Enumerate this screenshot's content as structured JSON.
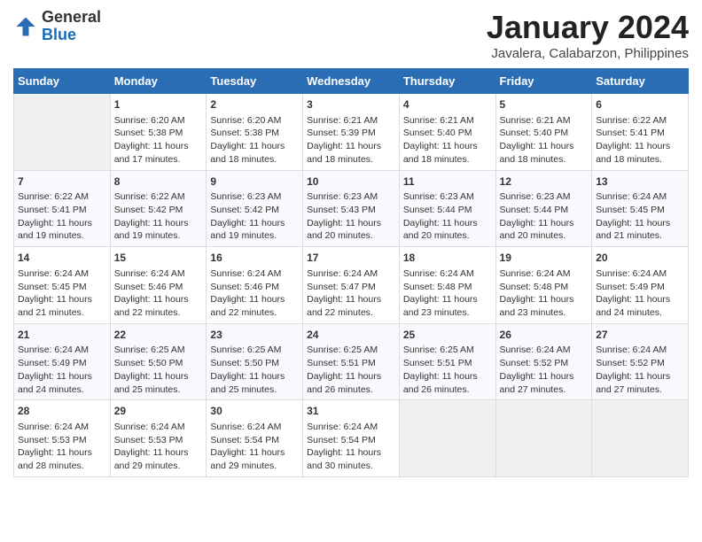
{
  "logo": {
    "general": "General",
    "blue": "Blue"
  },
  "header": {
    "month": "January 2024",
    "location": "Javalera, Calabarzon, Philippines"
  },
  "weekdays": [
    "Sunday",
    "Monday",
    "Tuesday",
    "Wednesday",
    "Thursday",
    "Friday",
    "Saturday"
  ],
  "weeks": [
    [
      {
        "day": "",
        "empty": true
      },
      {
        "day": "1",
        "sunrise": "6:20 AM",
        "sunset": "5:38 PM",
        "daylight": "11 hours and 17 minutes."
      },
      {
        "day": "2",
        "sunrise": "6:20 AM",
        "sunset": "5:38 PM",
        "daylight": "11 hours and 18 minutes."
      },
      {
        "day": "3",
        "sunrise": "6:21 AM",
        "sunset": "5:39 PM",
        "daylight": "11 hours and 18 minutes."
      },
      {
        "day": "4",
        "sunrise": "6:21 AM",
        "sunset": "5:40 PM",
        "daylight": "11 hours and 18 minutes."
      },
      {
        "day": "5",
        "sunrise": "6:21 AM",
        "sunset": "5:40 PM",
        "daylight": "11 hours and 18 minutes."
      },
      {
        "day": "6",
        "sunrise": "6:22 AM",
        "sunset": "5:41 PM",
        "daylight": "11 hours and 18 minutes."
      }
    ],
    [
      {
        "day": "7",
        "sunrise": "6:22 AM",
        "sunset": "5:41 PM",
        "daylight": "11 hours and 19 minutes."
      },
      {
        "day": "8",
        "sunrise": "6:22 AM",
        "sunset": "5:42 PM",
        "daylight": "11 hours and 19 minutes."
      },
      {
        "day": "9",
        "sunrise": "6:23 AM",
        "sunset": "5:42 PM",
        "daylight": "11 hours and 19 minutes."
      },
      {
        "day": "10",
        "sunrise": "6:23 AM",
        "sunset": "5:43 PM",
        "daylight": "11 hours and 20 minutes."
      },
      {
        "day": "11",
        "sunrise": "6:23 AM",
        "sunset": "5:44 PM",
        "daylight": "11 hours and 20 minutes."
      },
      {
        "day": "12",
        "sunrise": "6:23 AM",
        "sunset": "5:44 PM",
        "daylight": "11 hours and 20 minutes."
      },
      {
        "day": "13",
        "sunrise": "6:24 AM",
        "sunset": "5:45 PM",
        "daylight": "11 hours and 21 minutes."
      }
    ],
    [
      {
        "day": "14",
        "sunrise": "6:24 AM",
        "sunset": "5:45 PM",
        "daylight": "11 hours and 21 minutes."
      },
      {
        "day": "15",
        "sunrise": "6:24 AM",
        "sunset": "5:46 PM",
        "daylight": "11 hours and 22 minutes."
      },
      {
        "day": "16",
        "sunrise": "6:24 AM",
        "sunset": "5:46 PM",
        "daylight": "11 hours and 22 minutes."
      },
      {
        "day": "17",
        "sunrise": "6:24 AM",
        "sunset": "5:47 PM",
        "daylight": "11 hours and 22 minutes."
      },
      {
        "day": "18",
        "sunrise": "6:24 AM",
        "sunset": "5:48 PM",
        "daylight": "11 hours and 23 minutes."
      },
      {
        "day": "19",
        "sunrise": "6:24 AM",
        "sunset": "5:48 PM",
        "daylight": "11 hours and 23 minutes."
      },
      {
        "day": "20",
        "sunrise": "6:24 AM",
        "sunset": "5:49 PM",
        "daylight": "11 hours and 24 minutes."
      }
    ],
    [
      {
        "day": "21",
        "sunrise": "6:24 AM",
        "sunset": "5:49 PM",
        "daylight": "11 hours and 24 minutes."
      },
      {
        "day": "22",
        "sunrise": "6:25 AM",
        "sunset": "5:50 PM",
        "daylight": "11 hours and 25 minutes."
      },
      {
        "day": "23",
        "sunrise": "6:25 AM",
        "sunset": "5:50 PM",
        "daylight": "11 hours and 25 minutes."
      },
      {
        "day": "24",
        "sunrise": "6:25 AM",
        "sunset": "5:51 PM",
        "daylight": "11 hours and 26 minutes."
      },
      {
        "day": "25",
        "sunrise": "6:25 AM",
        "sunset": "5:51 PM",
        "daylight": "11 hours and 26 minutes."
      },
      {
        "day": "26",
        "sunrise": "6:24 AM",
        "sunset": "5:52 PM",
        "daylight": "11 hours and 27 minutes."
      },
      {
        "day": "27",
        "sunrise": "6:24 AM",
        "sunset": "5:52 PM",
        "daylight": "11 hours and 27 minutes."
      }
    ],
    [
      {
        "day": "28",
        "sunrise": "6:24 AM",
        "sunset": "5:53 PM",
        "daylight": "11 hours and 28 minutes."
      },
      {
        "day": "29",
        "sunrise": "6:24 AM",
        "sunset": "5:53 PM",
        "daylight": "11 hours and 29 minutes."
      },
      {
        "day": "30",
        "sunrise": "6:24 AM",
        "sunset": "5:54 PM",
        "daylight": "11 hours and 29 minutes."
      },
      {
        "day": "31",
        "sunrise": "6:24 AM",
        "sunset": "5:54 PM",
        "daylight": "11 hours and 30 minutes."
      },
      {
        "day": "",
        "empty": true
      },
      {
        "day": "",
        "empty": true
      },
      {
        "day": "",
        "empty": true
      }
    ]
  ],
  "labels": {
    "sunrise": "Sunrise:",
    "sunset": "Sunset:",
    "daylight": "Daylight:"
  }
}
